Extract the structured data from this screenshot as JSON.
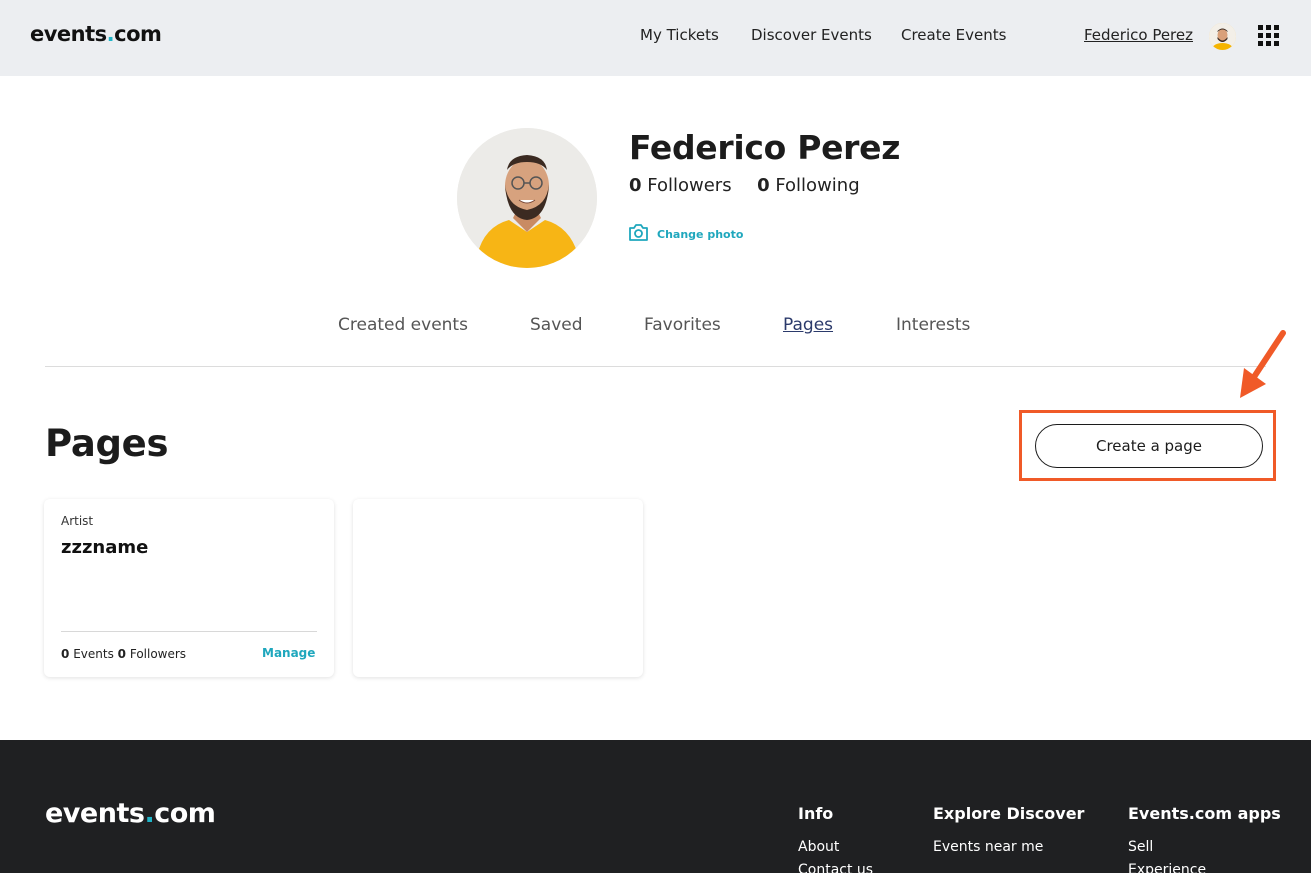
{
  "header": {
    "logo_main": "events",
    "logo_dot": ".",
    "logo_tld": "com",
    "nav": [
      "My Tickets",
      "Discover Events",
      "Create Events"
    ],
    "user_name": "Federico Perez"
  },
  "profile": {
    "name": "Federico Perez",
    "followers_count": "0",
    "followers_label": "Followers",
    "following_count": "0",
    "following_label": "Following",
    "change_photo": "Change photo"
  },
  "tabs": [
    {
      "label": "Created events",
      "active": false
    },
    {
      "label": "Saved",
      "active": false
    },
    {
      "label": "Favorites",
      "active": false
    },
    {
      "label": "Pages",
      "active": true
    },
    {
      "label": "Interests",
      "active": false
    }
  ],
  "pages_section": {
    "title": "Pages",
    "create_button": "Create a page",
    "cards": [
      {
        "type": "Artist",
        "name": "zzzname",
        "events_count": "0",
        "events_label": "Events",
        "followers_count": "0",
        "followers_label": "Followers",
        "manage": "Manage"
      }
    ]
  },
  "footer": {
    "logo_main": "events",
    "logo_dot": ".",
    "logo_tld": "com",
    "columns": [
      {
        "heading": "Info",
        "links": [
          "About",
          "Contact us"
        ]
      },
      {
        "heading": "Explore Discover",
        "links": [
          "Events near me"
        ]
      },
      {
        "heading": "Events.com apps",
        "links": [
          "Sell",
          "Experience"
        ]
      }
    ]
  },
  "colors": {
    "accent": "#1fa7bd",
    "annotation": "#f05a28",
    "header_bg": "#eceef1",
    "footer_bg": "#1f2022"
  },
  "icons": [
    "grid-menu-icon",
    "camera-icon",
    "annotation-arrow-icon"
  ]
}
